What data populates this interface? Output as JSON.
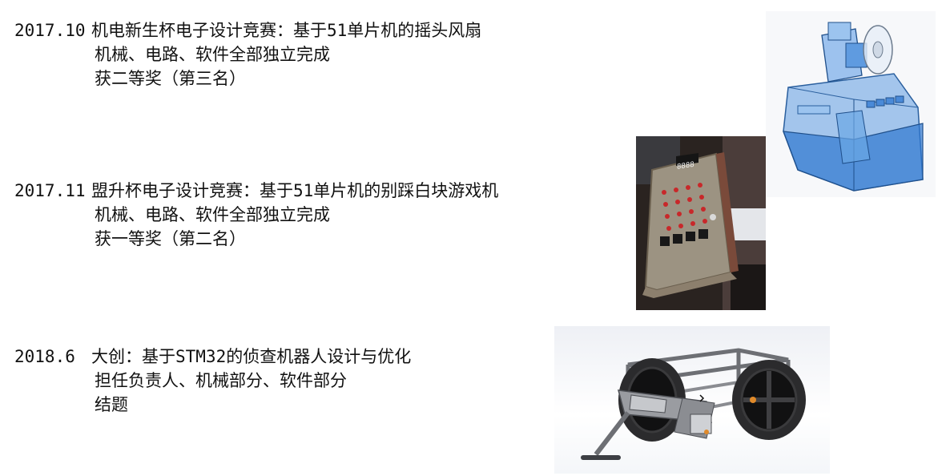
{
  "entries": [
    {
      "date": "2017.10",
      "title": "机电新生杯电子设计竞赛：基于51单片机的摇头风扇",
      "detail": "机械、电路、软件全部独立完成",
      "result": "获二等奖（第三名）",
      "image_icon": "oscillating-fan-cad-model"
    },
    {
      "date": "2017.11",
      "title": "盟升杯电子设计竞赛：基于51单片机的别踩白块游戏机",
      "detail": "机械、电路、软件全部独立完成",
      "result": "获一等奖（第二名）",
      "image_icon": "game-console-board-photo"
    },
    {
      "date": "2018.6",
      "title": "大创：基于STM32的侦查机器人设计与优化",
      "detail": "担任负责人、机械部分、软件部分",
      "result": "结题",
      "image_icon": "reconnaissance-robot-cad-model"
    }
  ],
  "colors": {
    "text": "#111111",
    "cad_blue": "#3f7fc6",
    "board_red": "#c8282a"
  }
}
